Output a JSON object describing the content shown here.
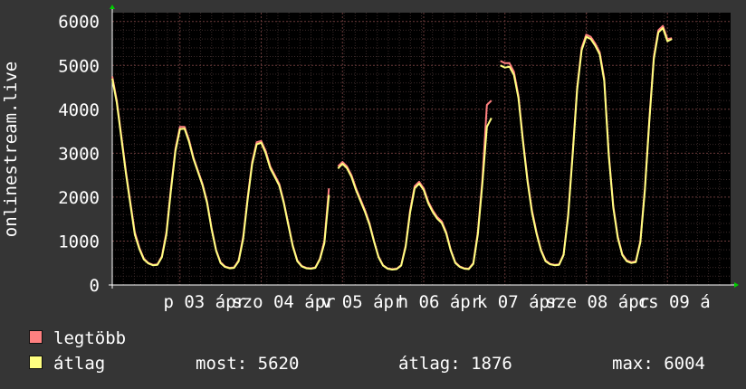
{
  "chart_data": {
    "type": "line",
    "ylabel": "onlinestream.live",
    "ylim": [
      0,
      6200
    ],
    "yticks": [
      0,
      1000,
      2000,
      3000,
      4000,
      5000,
      6000
    ],
    "grid": true,
    "xlim": [
      0,
      137
    ],
    "x_tick_labels": [
      "p 03 ápr",
      "szo 04 ápr",
      "v 05 ápr",
      "h 06 ápr",
      "k 07 ápr",
      "sze 08 ápr",
      "cs 09 á"
    ],
    "series": [
      {
        "name": "legtöbb",
        "color": "#ff8080",
        "points": [
          [
            0,
            4750
          ],
          [
            1,
            4200
          ],
          [
            2,
            3400
          ],
          [
            3,
            2600
          ],
          [
            4,
            1900
          ],
          [
            5,
            1200
          ],
          [
            6,
            850
          ],
          [
            7,
            600
          ],
          [
            8,
            500
          ],
          [
            9,
            460
          ],
          [
            10,
            470
          ],
          [
            11,
            650
          ],
          [
            12,
            1200
          ],
          [
            13,
            2200
          ],
          [
            14,
            3100
          ],
          [
            15,
            3600
          ],
          [
            16,
            3600
          ],
          [
            17,
            3300
          ],
          [
            18,
            2900
          ],
          [
            19,
            2600
          ],
          [
            20,
            2300
          ],
          [
            21,
            1900
          ],
          [
            22,
            1300
          ],
          [
            23,
            800
          ],
          [
            24,
            520
          ],
          [
            25,
            420
          ],
          [
            26,
            390
          ],
          [
            27,
            400
          ],
          [
            28,
            560
          ],
          [
            29,
            1100
          ],
          [
            30,
            2000
          ],
          [
            31,
            2800
          ],
          [
            32,
            3250
          ],
          [
            33,
            3280
          ],
          [
            34,
            3050
          ],
          [
            35,
            2700
          ],
          [
            36,
            2500
          ],
          [
            37,
            2300
          ],
          [
            38,
            1900
          ],
          [
            39,
            1400
          ],
          [
            40,
            900
          ],
          [
            41,
            560
          ],
          [
            42,
            430
          ],
          [
            43,
            390
          ],
          [
            44,
            380
          ],
          [
            45,
            400
          ],
          [
            46,
            600
          ],
          [
            47,
            1000
          ],
          [
            48,
            2200
          ],
          [
            49,
            null
          ],
          [
            50,
            2700
          ],
          [
            51,
            2800
          ],
          [
            52,
            2700
          ],
          [
            53,
            2500
          ],
          [
            54,
            2200
          ],
          [
            55,
            1950
          ],
          [
            56,
            1700
          ],
          [
            57,
            1400
          ],
          [
            58,
            1000
          ],
          [
            59,
            650
          ],
          [
            60,
            450
          ],
          [
            61,
            380
          ],
          [
            62,
            360
          ],
          [
            63,
            370
          ],
          [
            64,
            450
          ],
          [
            65,
            900
          ],
          [
            66,
            1700
          ],
          [
            67,
            2250
          ],
          [
            68,
            2350
          ],
          [
            69,
            2200
          ],
          [
            70,
            1900
          ],
          [
            71,
            1700
          ],
          [
            72,
            1550
          ],
          [
            73,
            1450
          ],
          [
            74,
            1200
          ],
          [
            75,
            800
          ],
          [
            76,
            520
          ],
          [
            77,
            420
          ],
          [
            78,
            380
          ],
          [
            79,
            370
          ],
          [
            80,
            500
          ],
          [
            81,
            1200
          ],
          [
            82,
            2400
          ],
          [
            83,
            4100
          ],
          [
            84,
            4200
          ],
          [
            85,
            null
          ],
          [
            86,
            5100
          ],
          [
            87,
            5050
          ],
          [
            88,
            5050
          ],
          [
            89,
            4850
          ],
          [
            90,
            4300
          ],
          [
            91,
            3300
          ],
          [
            92,
            2400
          ],
          [
            93,
            1700
          ],
          [
            94,
            1200
          ],
          [
            95,
            800
          ],
          [
            96,
            560
          ],
          [
            97,
            480
          ],
          [
            98,
            460
          ],
          [
            99,
            470
          ],
          [
            100,
            700
          ],
          [
            101,
            1600
          ],
          [
            102,
            3000
          ],
          [
            103,
            4500
          ],
          [
            104,
            5400
          ],
          [
            105,
            5700
          ],
          [
            106,
            5650
          ],
          [
            107,
            5500
          ],
          [
            108,
            5300
          ],
          [
            109,
            4700
          ],
          [
            110,
            3000
          ],
          [
            111,
            1800
          ],
          [
            112,
            1100
          ],
          [
            113,
            700
          ],
          [
            114,
            560
          ],
          [
            115,
            520
          ],
          [
            116,
            540
          ],
          [
            117,
            1000
          ],
          [
            118,
            2200
          ],
          [
            119,
            3800
          ],
          [
            120,
            5200
          ],
          [
            121,
            5800
          ],
          [
            122,
            5900
          ],
          [
            123,
            5600
          ],
          [
            124,
            5620
          ]
        ]
      },
      {
        "name": "átlag",
        "color": "#ffff80",
        "points": [
          [
            0,
            4700
          ],
          [
            1,
            4150
          ],
          [
            2,
            3350
          ],
          [
            3,
            2550
          ],
          [
            4,
            1850
          ],
          [
            5,
            1150
          ],
          [
            6,
            820
          ],
          [
            7,
            580
          ],
          [
            8,
            490
          ],
          [
            9,
            450
          ],
          [
            10,
            460
          ],
          [
            11,
            630
          ],
          [
            12,
            1150
          ],
          [
            13,
            2150
          ],
          [
            14,
            3050
          ],
          [
            15,
            3550
          ],
          [
            16,
            3560
          ],
          [
            17,
            3260
          ],
          [
            18,
            2870
          ],
          [
            19,
            2570
          ],
          [
            20,
            2270
          ],
          [
            21,
            1870
          ],
          [
            22,
            1270
          ],
          [
            23,
            780
          ],
          [
            24,
            500
          ],
          [
            25,
            410
          ],
          [
            26,
            380
          ],
          [
            27,
            390
          ],
          [
            28,
            540
          ],
          [
            29,
            1050
          ],
          [
            30,
            1950
          ],
          [
            31,
            2750
          ],
          [
            32,
            3200
          ],
          [
            33,
            3240
          ],
          [
            34,
            3000
          ],
          [
            35,
            2660
          ],
          [
            36,
            2460
          ],
          [
            37,
            2260
          ],
          [
            38,
            1870
          ],
          [
            39,
            1370
          ],
          [
            40,
            880
          ],
          [
            41,
            540
          ],
          [
            42,
            420
          ],
          [
            43,
            380
          ],
          [
            44,
            370
          ],
          [
            45,
            390
          ],
          [
            46,
            580
          ],
          [
            47,
            950
          ],
          [
            48,
            2050
          ],
          [
            49,
            null
          ],
          [
            50,
            2650
          ],
          [
            51,
            2760
          ],
          [
            52,
            2660
          ],
          [
            53,
            2460
          ],
          [
            54,
            2160
          ],
          [
            55,
            1910
          ],
          [
            56,
            1660
          ],
          [
            57,
            1370
          ],
          [
            58,
            980
          ],
          [
            59,
            630
          ],
          [
            60,
            440
          ],
          [
            61,
            370
          ],
          [
            62,
            350
          ],
          [
            63,
            360
          ],
          [
            64,
            440
          ],
          [
            65,
            870
          ],
          [
            66,
            1650
          ],
          [
            67,
            2200
          ],
          [
            68,
            2310
          ],
          [
            69,
            2160
          ],
          [
            70,
            1860
          ],
          [
            71,
            1660
          ],
          [
            72,
            1510
          ],
          [
            73,
            1410
          ],
          [
            74,
            1170
          ],
          [
            75,
            780
          ],
          [
            76,
            500
          ],
          [
            77,
            410
          ],
          [
            78,
            370
          ],
          [
            79,
            360
          ],
          [
            80,
            480
          ],
          [
            81,
            1150
          ],
          [
            82,
            2300
          ],
          [
            83,
            3600
          ],
          [
            84,
            3800
          ],
          [
            85,
            null
          ],
          [
            86,
            5000
          ],
          [
            87,
            4950
          ],
          [
            88,
            4970
          ],
          [
            89,
            4780
          ],
          [
            90,
            4250
          ],
          [
            91,
            3250
          ],
          [
            92,
            2350
          ],
          [
            93,
            1650
          ],
          [
            94,
            1170
          ],
          [
            95,
            780
          ],
          [
            96,
            540
          ],
          [
            97,
            470
          ],
          [
            98,
            450
          ],
          [
            99,
            460
          ],
          [
            100,
            680
          ],
          [
            101,
            1550
          ],
          [
            102,
            2950
          ],
          [
            103,
            4450
          ],
          [
            104,
            5350
          ],
          [
            105,
            5650
          ],
          [
            106,
            5600
          ],
          [
            107,
            5450
          ],
          [
            108,
            5250
          ],
          [
            109,
            4650
          ],
          [
            110,
            2950
          ],
          [
            111,
            1760
          ],
          [
            112,
            1070
          ],
          [
            113,
            680
          ],
          [
            114,
            540
          ],
          [
            115,
            500
          ],
          [
            116,
            520
          ],
          [
            117,
            970
          ],
          [
            118,
            2150
          ],
          [
            119,
            3750
          ],
          [
            120,
            5150
          ],
          [
            121,
            5750
          ],
          [
            122,
            5850
          ],
          [
            123,
            5550
          ],
          [
            124,
            5600
          ]
        ]
      }
    ],
    "legend": [
      {
        "label": "legtöbb",
        "color": "#ff8080"
      },
      {
        "label": "átlag",
        "color": "#ffff80"
      }
    ],
    "stats": {
      "most": "most: 5620",
      "atlag": "átlag: 1876",
      "max": "max: 6004"
    }
  }
}
